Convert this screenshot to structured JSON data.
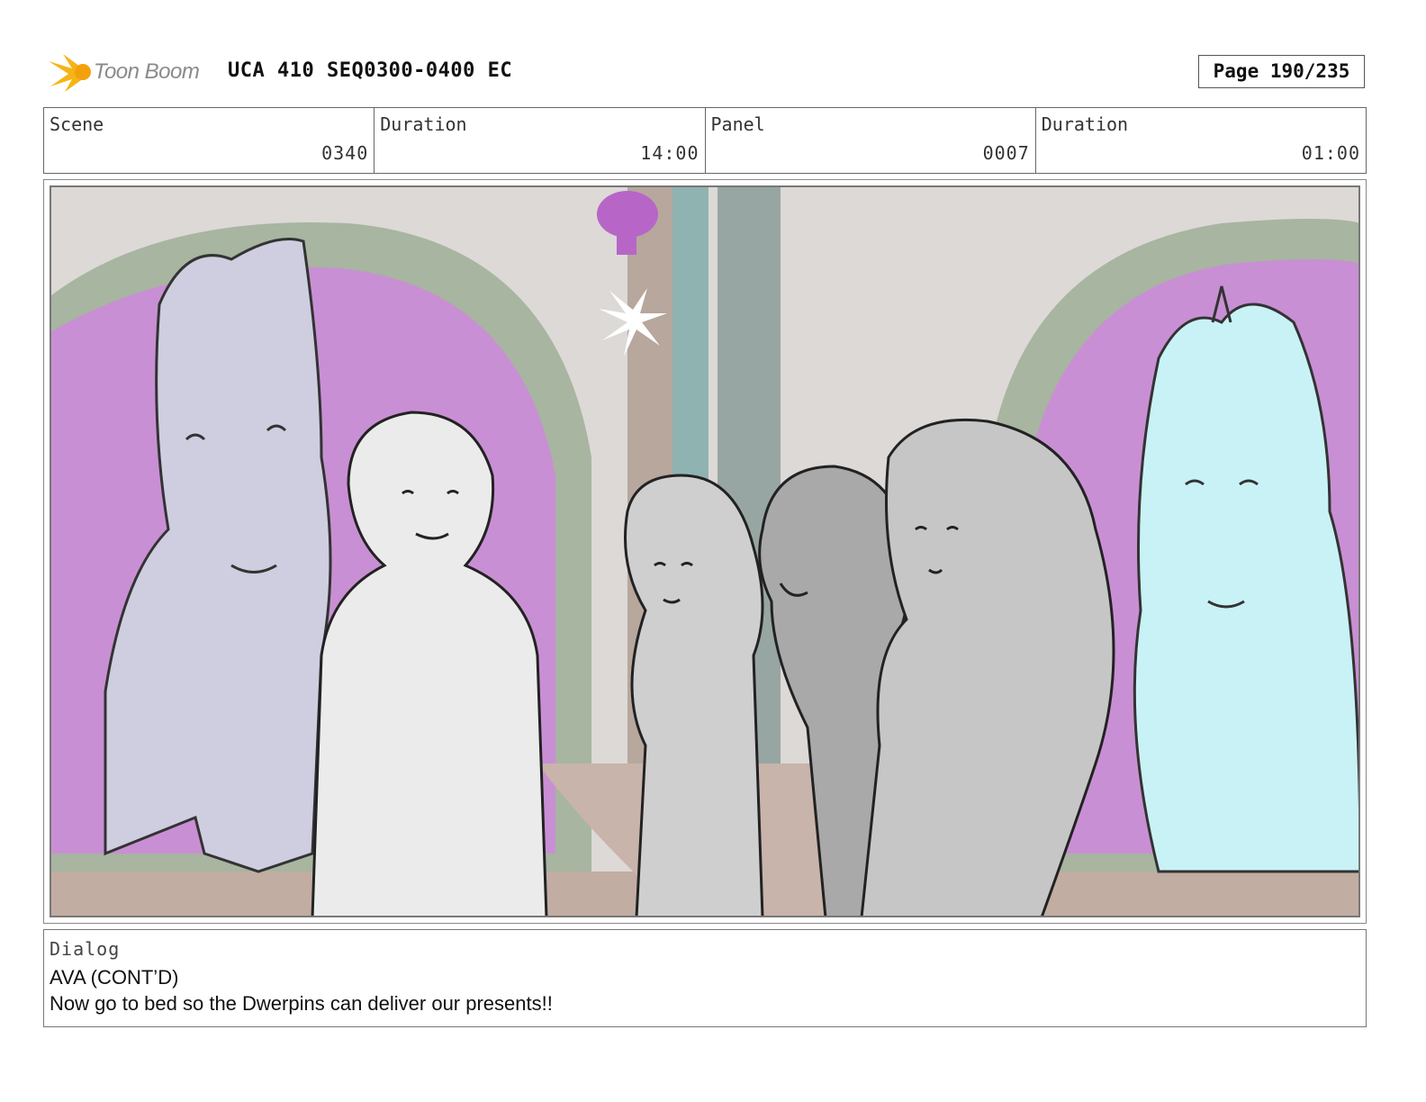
{
  "header": {
    "logo_text": "Toon Boom",
    "doc_title": "UCA 410 SEQ0300-0400 EC",
    "page_label": "Page 190/235"
  },
  "info": {
    "scene_label": "Scene",
    "scene_value": "0340",
    "scene_duration_label": "Duration",
    "scene_duration_value": "14:00",
    "panel_label": "Panel",
    "panel_value": "0007",
    "panel_duration_label": "Duration",
    "panel_duration_value": "01:00"
  },
  "dialog": {
    "label": "Dialog",
    "character": "AVA (CONT’D)",
    "line": "Now go to bed so the Dwerpins can deliver our presents!!"
  },
  "colors": {
    "arch_magenta": "#c98fd4",
    "arch_green": "#9fb09a",
    "horse_left": "#cfcde0",
    "unicorn_right": "#c9f2f6",
    "floor": "#c2ada2"
  }
}
